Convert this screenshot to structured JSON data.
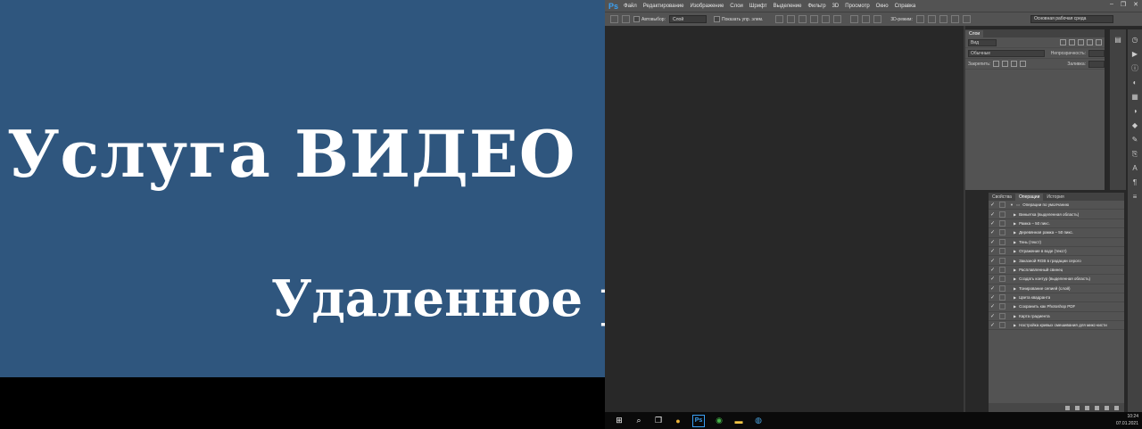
{
  "video": {
    "title": "Услуга ВИДЕО",
    "subtitle": "Удаленное р",
    "bg_color": "#2f567e"
  },
  "photoshop": {
    "logo": "Ps",
    "menu": [
      "Файл",
      "Редактирование",
      "Изображение",
      "Слои",
      "Шрифт",
      "Выделение",
      "Фильтр",
      "3D",
      "Просмотр",
      "Окно",
      "Справка"
    ],
    "options": {
      "autoselect_label": "Автовыбор:",
      "autoselect_value": "Слой",
      "show_controls_label": "Показать упр. элем.",
      "mode_3d_label": "3D-режим:",
      "workspace": "Основная рабочая среда"
    },
    "layers_panel": {
      "tab": "Слои",
      "kind_filter": "Вид",
      "blend_mode": "Обычные",
      "opacity_label": "Непрозрачность:",
      "lock_label": "Закрепить:",
      "fill_label": "Заливка:"
    },
    "actions_panel": {
      "tabs": [
        "Свойства",
        "Операции",
        "История"
      ],
      "active_tab": "Операции",
      "set_name": "Операции по умолчанию",
      "items": [
        "Виньетка (выделенная область)",
        "Рамка – 50 пикс.",
        "Деревянная рамка – 50 пикс.",
        "Тень (текст)",
        "Отражение в воде (текст)",
        "Заказной RGB в градации серого",
        "Расплавленный свинец",
        "Создать контур (выделенная область)",
        "Тонирование сепией (слой)",
        "Цвета квадранта",
        "Сохранить как Photoshop PDF",
        "Карта градиента",
        "Настройка кривых смешивания для микс-кисти"
      ]
    }
  },
  "taskbar": {
    "time": "10:24",
    "date": "07.01.2021"
  }
}
